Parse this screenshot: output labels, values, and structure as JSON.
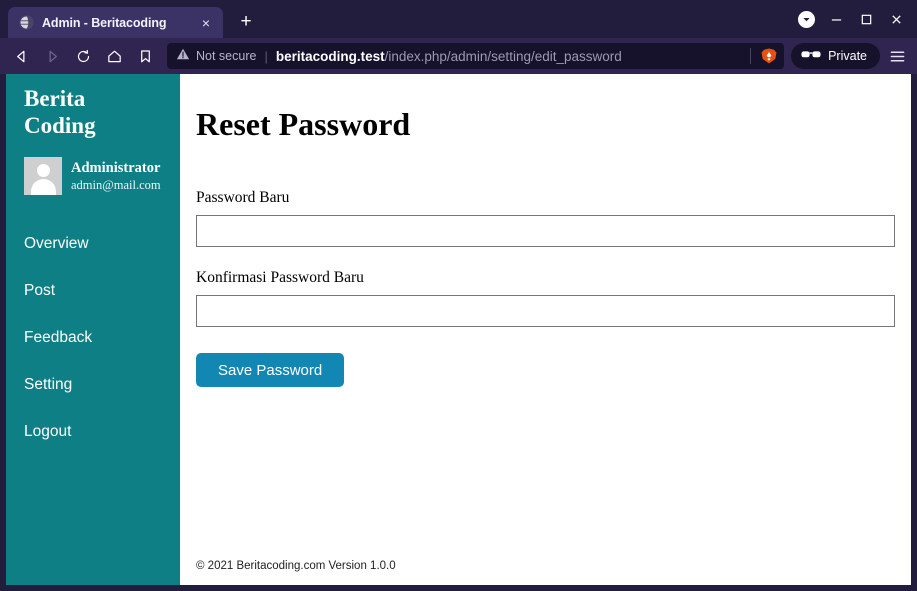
{
  "browser": {
    "tab": {
      "title": "Admin - Beritacoding",
      "favicon": "globe-icon",
      "close_label": "×"
    },
    "newtab_label": "+",
    "window_controls": {
      "profile_label": "▼",
      "minimize_label": "—",
      "maximize_label": "□",
      "close_label": "✕"
    },
    "nav": {
      "back": "back-arrow-icon",
      "forward": "forward-arrow-icon",
      "reload": "reload-icon",
      "home": "home-icon",
      "bookmark": "bookmark-icon"
    },
    "urlbar": {
      "security_label": "Not secure",
      "security_icon": "warning-triangle-icon",
      "separator": "|",
      "host": "beritacoding.test",
      "path": "/index.php/admin/setting/edit_password",
      "full_url": "beritacoding.test/index.php/admin/setting/edit_password",
      "shields_icon": "brave-lion-icon"
    },
    "private_button": {
      "label": "Private",
      "icon": "sunglasses-icon"
    },
    "menu_icon": "hamburger-menu-icon"
  },
  "sidebar": {
    "brand_line1": "Berita",
    "brand_line2": "Coding",
    "user": {
      "name": "Administrator",
      "email": "admin@mail.com",
      "avatar": "user-avatar-placeholder"
    },
    "items": [
      {
        "label": "Overview"
      },
      {
        "label": "Post"
      },
      {
        "label": "Feedback"
      },
      {
        "label": "Setting"
      },
      {
        "label": "Logout"
      }
    ]
  },
  "main": {
    "title": "Reset Password",
    "fields": [
      {
        "label": "Password Baru",
        "value": "",
        "placeholder": ""
      },
      {
        "label": "Konfirmasi Password Baru",
        "value": "",
        "placeholder": ""
      }
    ],
    "submit_label": "Save Password",
    "footer": "© 2021 Beritacoding.com Version 1.0.0"
  },
  "colors": {
    "sidebar_teal": "#0e7f85",
    "button_blue": "#1287b4",
    "browser_chrome": "#2f2550",
    "titlebar": "#231d3d",
    "tab_active": "#3b3266",
    "urlbar_bg": "#16122b",
    "brave_orange": "#e8500f"
  }
}
